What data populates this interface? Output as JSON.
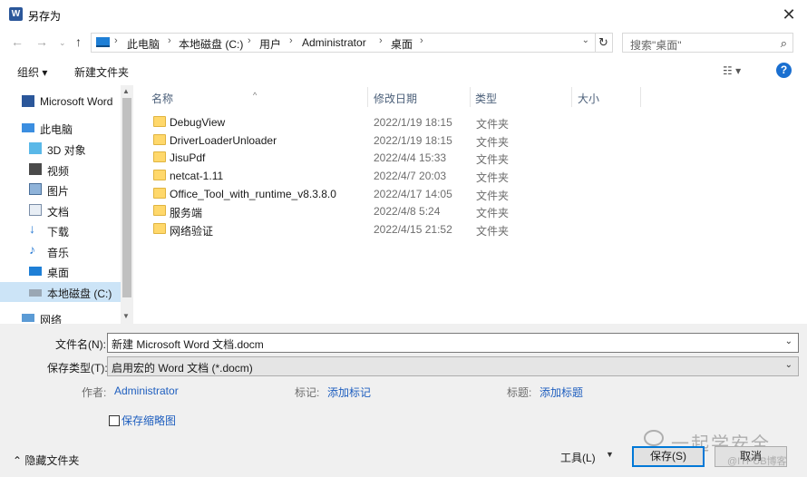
{
  "window": {
    "title": "另存为"
  },
  "address": {
    "crumbs": [
      "此电脑",
      "本地磁盘 (C:)",
      "用户",
      "Administrator",
      "桌面"
    ],
    "search_placeholder": "搜索\"桌面\""
  },
  "toolbar": {
    "organize": "组织 ▾",
    "new_folder": "新建文件夹"
  },
  "nav": {
    "items": [
      {
        "label": "Microsoft Word",
        "icon": "word-icon"
      },
      {
        "label": "此电脑",
        "icon": "computer-icon"
      },
      {
        "label": "3D 对象",
        "icon": "cube-icon"
      },
      {
        "label": "视频",
        "icon": "video-icon"
      },
      {
        "label": "图片",
        "icon": "picture-icon"
      },
      {
        "label": "文档",
        "icon": "document-icon"
      },
      {
        "label": "下载",
        "icon": "download-icon"
      },
      {
        "label": "音乐",
        "icon": "music-icon"
      },
      {
        "label": "桌面",
        "icon": "desktop-icon"
      },
      {
        "label": "本地磁盘 (C:)",
        "icon": "drive-icon"
      },
      {
        "label": "网络",
        "icon": "network-icon"
      }
    ]
  },
  "columns": {
    "name": "名称",
    "modified": "修改日期",
    "type": "类型",
    "size": "大小"
  },
  "files": [
    {
      "name": "DebugView",
      "date": "2022/1/19 18:15",
      "type": "文件夹"
    },
    {
      "name": "DriverLoaderUnloader",
      "date": "2022/1/19 18:15",
      "type": "文件夹"
    },
    {
      "name": "JisuPdf",
      "date": "2022/4/4 15:33",
      "type": "文件夹"
    },
    {
      "name": "netcat-1.11",
      "date": "2022/4/7 20:03",
      "type": "文件夹"
    },
    {
      "name": "Office_Tool_with_runtime_v8.3.8.0",
      "date": "2022/4/17 14:05",
      "type": "文件夹"
    },
    {
      "name": "服务端",
      "date": "2022/4/8 5:24",
      "type": "文件夹"
    },
    {
      "name": "网络验证",
      "date": "2022/4/15 21:52",
      "type": "文件夹"
    }
  ],
  "form": {
    "filename_label": "文件名(N):",
    "filename_value": "新建 Microsoft Word 文档.docm",
    "filetype_label": "保存类型(T):",
    "filetype_value": "启用宏的 Word 文档 (*.docm)",
    "author_label": "作者:",
    "author_value": "Administrator",
    "tags_label": "标记:",
    "tags_value": "添加标记",
    "title_label": "标题:",
    "title_value": "添加标题",
    "thumbnail_label": "保存缩略图"
  },
  "footer": {
    "hide_folders": "隐藏文件夹",
    "tools": "工具(L)",
    "save": "保存(S)",
    "cancel": "取消",
    "watermark": "一起学安全",
    "watermark_sub": "@ITPUB博客"
  }
}
